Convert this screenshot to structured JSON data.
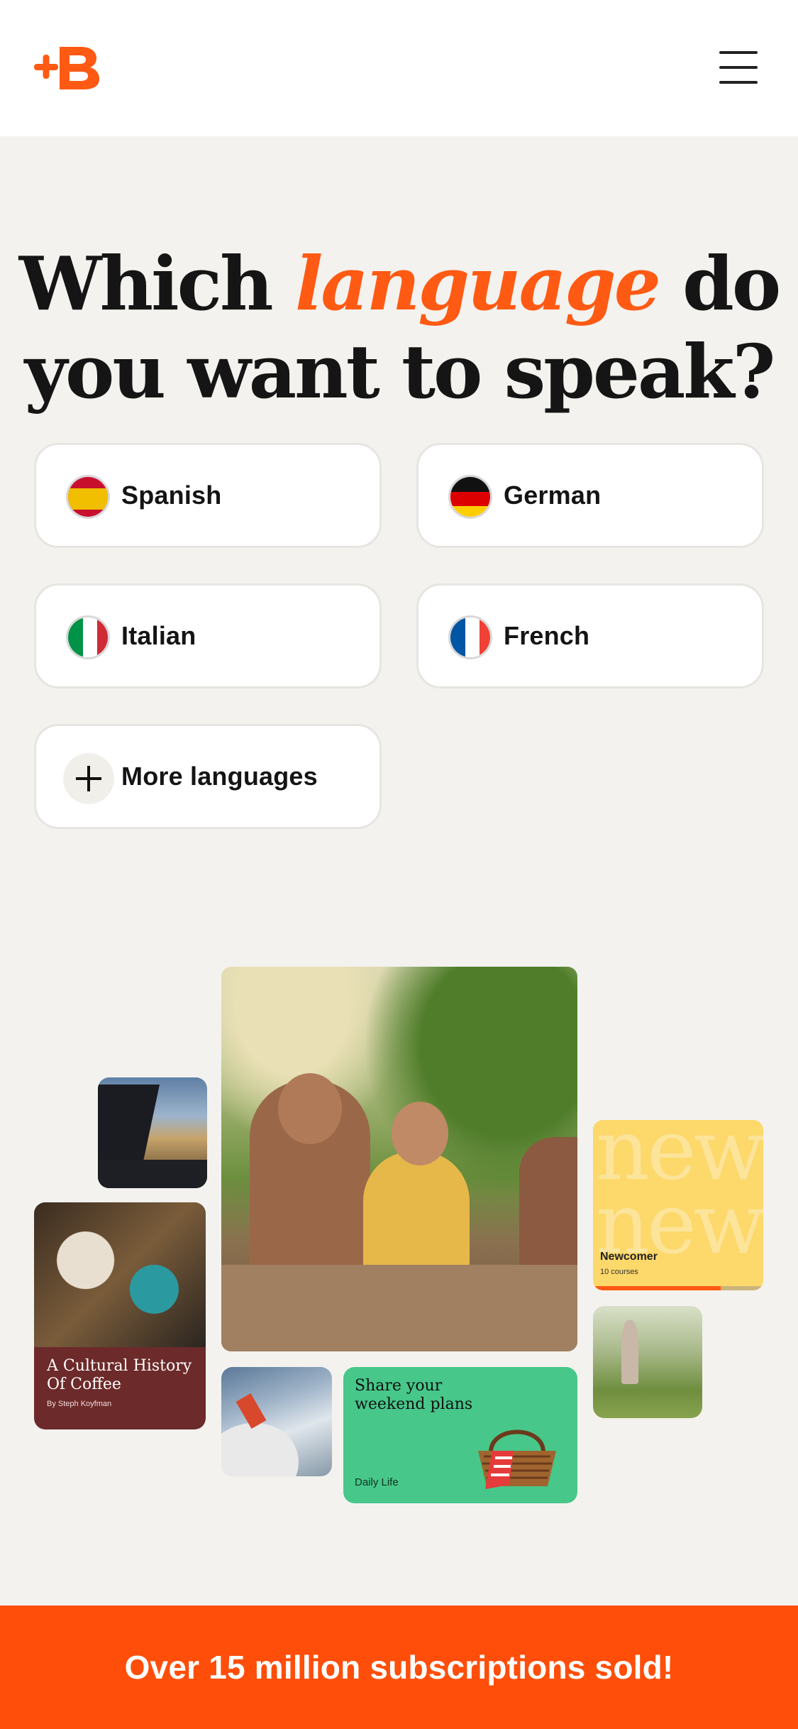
{
  "header": {
    "logo_alt": "+B",
    "menu_icon": "hamburger-menu-icon"
  },
  "headline": {
    "before": "Which ",
    "highlight": "language",
    "after": " do you want to speak?"
  },
  "languages": [
    {
      "label": "Spanish",
      "icon": "spain-flag-icon"
    },
    {
      "label": "German",
      "icon": "germany-flag-icon"
    },
    {
      "label": "Italian",
      "icon": "italy-flag-icon"
    },
    {
      "label": "French",
      "icon": "france-flag-icon"
    },
    {
      "label": "More languages",
      "icon": "plus-icon"
    }
  ],
  "tiles": {
    "coffee": {
      "title": "A Cultural History Of Coffee",
      "author": "By Steph Koyfman"
    },
    "newcomer": {
      "bg_word": "new",
      "title": "Newcomer",
      "subtitle": "10 courses",
      "progress": 0.75
    },
    "weekend": {
      "title": "Share your weekend plans",
      "category": "Daily Life"
    }
  },
  "banner": {
    "text": "Over 15 million subscriptions sold!"
  },
  "colors": {
    "accent": "#ff5a14",
    "banner": "#ff4e0a",
    "background": "#f3f2ee",
    "green_card": "#47c78a",
    "yellow_card": "#fdd86a",
    "coffee_card": "#6d2a2a"
  }
}
